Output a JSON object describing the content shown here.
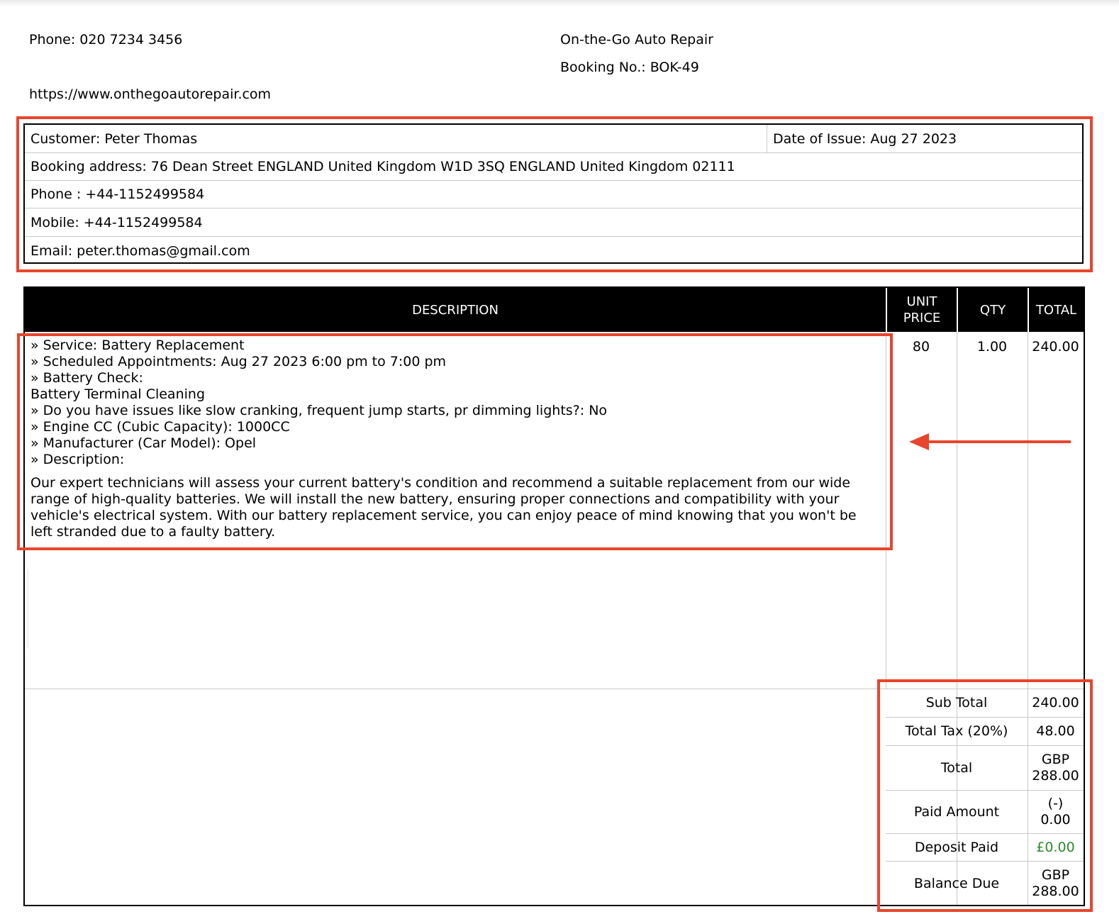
{
  "header": {
    "phone": "Phone: 020 7234 3456",
    "website": "https://www.onthegoautorepair.com",
    "company": "On-the-Go Auto Repair",
    "booking_no": "Booking No.: BOK-49"
  },
  "customer": {
    "name": "Customer: Peter Thomas",
    "date_of_issue": "Date of Issue: Aug 27 2023",
    "booking_address": "Booking address: 76 Dean Street ENGLAND United Kingdom W1D 3SQ ENGLAND United Kingdom 02111",
    "phone": "Phone : +44-1152499584",
    "mobile": "Mobile: +44-1152499584",
    "email": "Email: peter.thomas@gmail.com"
  },
  "table": {
    "headers": {
      "description": "DESCRIPTION",
      "unit_price_1": "UNIT",
      "unit_price_2": "PRICE",
      "qty": "QTY",
      "total": "TOTAL"
    },
    "item": {
      "lines": [
        "» Service:  Battery Replacement",
        "» Scheduled Appointments: Aug 27 2023 6:00 pm to 7:00 pm",
        "» Battery Check:",
        "Battery Terminal Cleaning",
        "» Do you have issues like slow cranking, frequent jump starts, pr dimming lights?:  No",
        "» Engine CC (Cubic Capacity):  1000CC",
        "» Manufacturer (Car Model):  Opel",
        "» Description:"
      ],
      "paragraph": "Our expert technicians will assess your current battery's condition and recommend a suitable replacement from our wide range of high-quality batteries. We will install the new battery, ensuring proper connections and compatibility with your vehicle's electrical system. With our battery replacement service, you can enjoy peace of mind knowing that you won't be left stranded due to a faulty battery.",
      "unit_price": "80",
      "qty": "1.00",
      "total": "240.00"
    }
  },
  "totals": {
    "sub_total_label": "Sub Total",
    "sub_total": "240.00",
    "tax_label": "Total Tax (20%)",
    "tax": "48.00",
    "total_label": "Total",
    "total_currency": "GBP",
    "total_amount": "288.00",
    "paid_label": "Paid Amount",
    "paid_sign": "(-)",
    "paid_amount": "0.00",
    "deposit_label": "Deposit Paid",
    "deposit": "£0.00",
    "balance_label": "Balance Due",
    "balance_currency": "GBP",
    "balance_amount": "288.00"
  },
  "colors": {
    "annotation": "#e8452c",
    "deposit_green": "#2a8a2a"
  }
}
